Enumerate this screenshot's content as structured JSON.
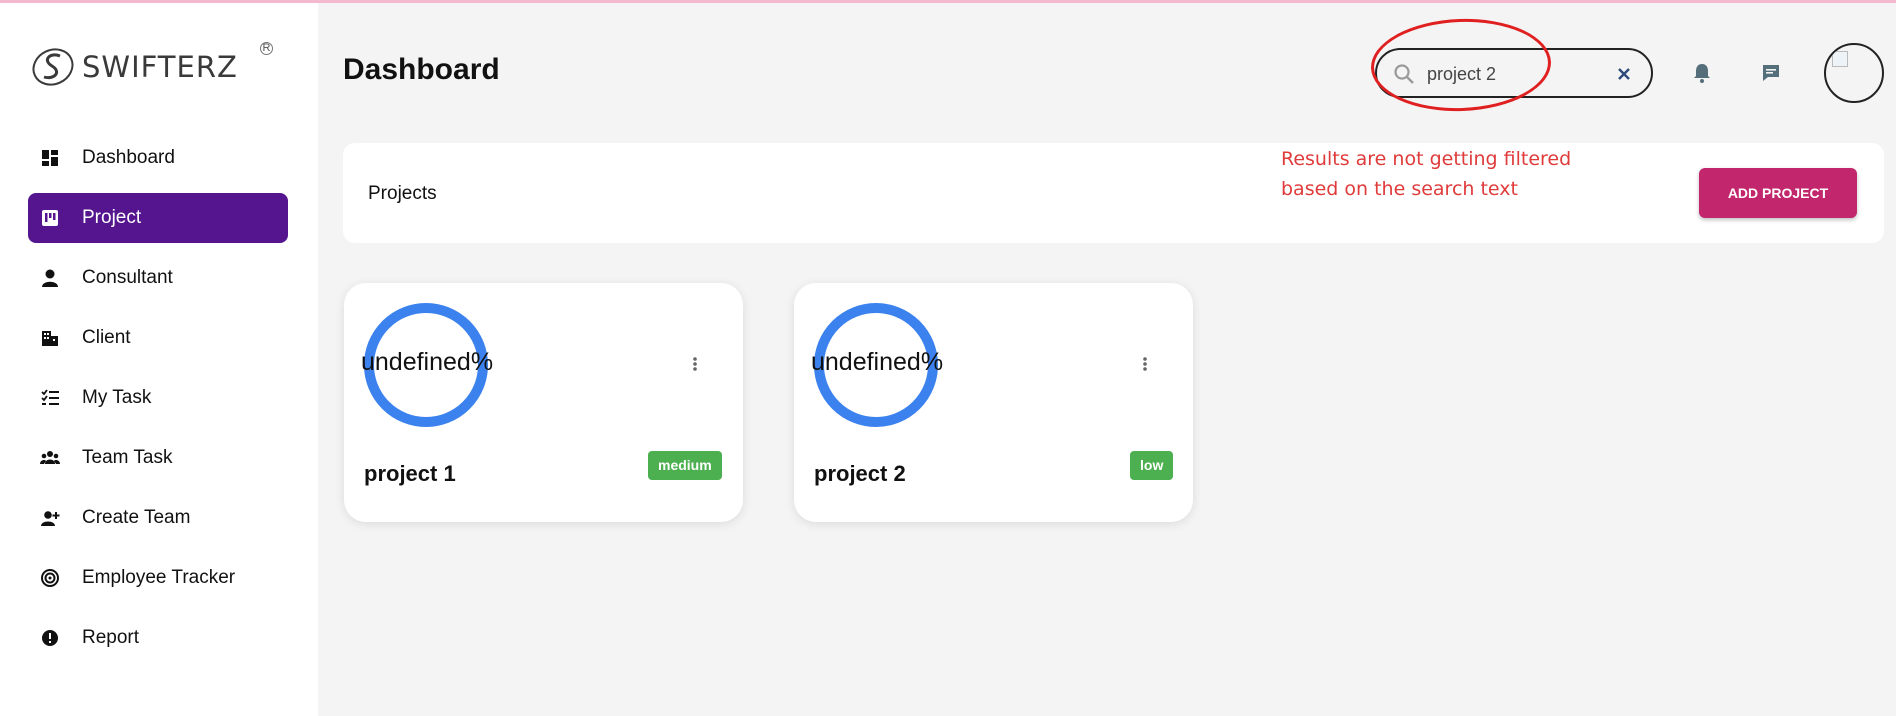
{
  "brand": {
    "name": "SWIFTERZ",
    "trademark": "R"
  },
  "sidebar": {
    "items": [
      {
        "label": "Dashboard",
        "icon": "dashboard-icon",
        "active": false
      },
      {
        "label": "Project",
        "icon": "project-board-icon",
        "active": true
      },
      {
        "label": "Consultant",
        "icon": "person-icon",
        "active": false
      },
      {
        "label": "Client",
        "icon": "building-icon",
        "active": false
      },
      {
        "label": "My Task",
        "icon": "checklist-icon",
        "active": false
      },
      {
        "label": "Team Task",
        "icon": "group-icon",
        "active": false
      },
      {
        "label": "Create Team",
        "icon": "add-person-icon",
        "active": false
      },
      {
        "label": "Employee Tracker",
        "icon": "radar-icon",
        "active": false
      },
      {
        "label": "Report",
        "icon": "alert-circle-icon",
        "active": false
      }
    ]
  },
  "header": {
    "title": "Dashboard",
    "search": {
      "value": "project 2",
      "placeholder": ""
    }
  },
  "projects_panel": {
    "title": "Projects",
    "add_button_label": "ADD PROJECT"
  },
  "annotation": {
    "note": "Results are not getting filtered based on the search text",
    "color": "#e03b3b"
  },
  "projects": [
    {
      "title": "project 1",
      "progress_label": "undefined%",
      "priority": "medium"
    },
    {
      "title": "project 2",
      "progress_label": "undefined%",
      "priority": "low"
    }
  ],
  "colors": {
    "accent": "#55158f",
    "add_button": "#c2266d",
    "ring": "#3c82ee",
    "priority_badge": "#4caf50"
  }
}
